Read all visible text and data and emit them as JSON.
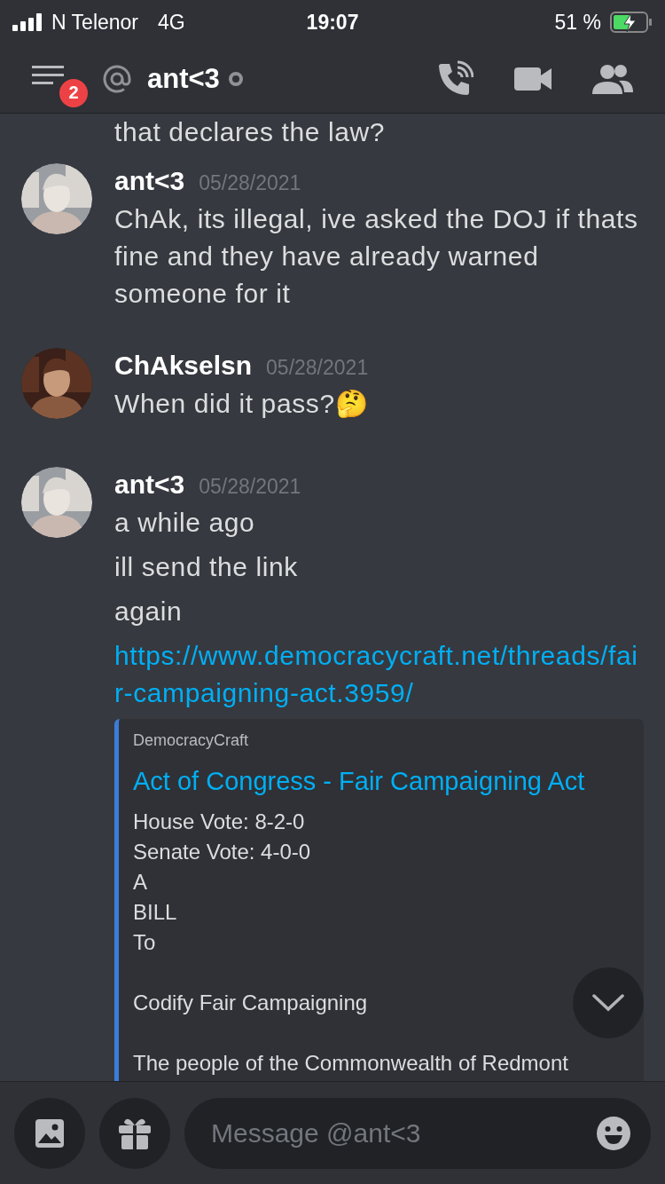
{
  "status_bar": {
    "carrier": "N Telenor",
    "network": "4G",
    "time": "19:07",
    "battery": "51 %"
  },
  "header": {
    "badge": "2",
    "title": "ant<3"
  },
  "clipped_text": "that declares the law?",
  "messages": [
    {
      "author": "ant<3",
      "timestamp": "05/28/2021",
      "lines": [
        {
          "kind": "text",
          "text": "ChAk, its illegal, ive asked the DOJ if thats fine and they have already warned someone for it"
        }
      ]
    },
    {
      "author": "ChAkselsn",
      "timestamp": "05/28/2021",
      "lines": [
        {
          "kind": "text",
          "text": "When did it pass?🤔"
        }
      ]
    },
    {
      "author": "ant<3",
      "timestamp": "05/28/2021",
      "lines": [
        {
          "kind": "text",
          "text": "a while ago"
        },
        {
          "kind": "text",
          "text": "ill send the link"
        },
        {
          "kind": "text",
          "text": "again"
        },
        {
          "kind": "link",
          "text": "https://www.democracycraft.net/threads/fair-campaigning-act.3959/"
        }
      ],
      "embed": {
        "provider": "DemocracyCraft",
        "title": "Act of Congress - Fair Campaigning Act",
        "paragraphs": [
          "House Vote: 8-2-0\nSenate Vote: 4-0-0\nA\nBILL\nTo",
          "Codify Fair Campaigning",
          "The people of the Commonwealth of Redmont"
        ]
      }
    }
  ],
  "composer": {
    "placeholder": "Message @ant<3"
  }
}
